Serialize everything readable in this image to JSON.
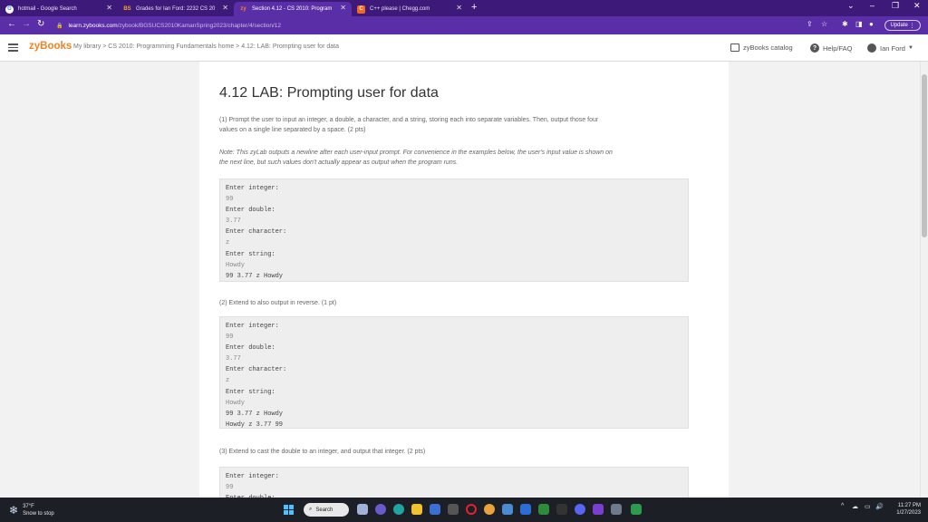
{
  "browser": {
    "tabs": [
      {
        "label": "hotmail - Google Search",
        "favicon_glyph": "G"
      },
      {
        "label": "Grades for Ian Ford: 2232 CS 20",
        "favicon_glyph": "BS"
      },
      {
        "label": "Section 4.12 - CS 2010: Program",
        "favicon_glyph": "zy"
      },
      {
        "label": "C++ please | Chegg.com",
        "favicon_glyph": "C"
      }
    ],
    "new_tab_glyph": "+",
    "url_host": "learn.zybooks.com",
    "url_path": "/zybook/BGSUCS2010KamanSpring2023/chapter/4/section/12",
    "update_label": "Update"
  },
  "header": {
    "logo": "zyBooks",
    "breadcrumb": "My library > CS 2010: Programming Fundamentals home > 4.12: LAB: Prompting user for data",
    "catalog_label": "zyBooks catalog",
    "help_label": "Help/FAQ",
    "user_label": "Ian Ford"
  },
  "content": {
    "title": "4.12 LAB: Prompting user for data",
    "intro_line1": "(1) Prompt the user to input an integer, a double, a character, and a string, storing each into separate variables. Then, output those four",
    "intro_line2": "values on a single line separated by a space. (2 pts)",
    "note_line1": "Note: This zyLab outputs a newline after each user-input prompt. For convenience in the examples below, the user's input value is shown on",
    "note_line2": "the next line, but such values don't actually appear as output when the program runs.",
    "example1": [
      {
        "text": "Enter integer:",
        "kind": "prompt"
      },
      {
        "text": "99",
        "kind": "input"
      },
      {
        "text": "Enter double:",
        "kind": "prompt"
      },
      {
        "text": "3.77",
        "kind": "input"
      },
      {
        "text": "Enter character:",
        "kind": "prompt"
      },
      {
        "text": "z",
        "kind": "input"
      },
      {
        "text": "Enter string:",
        "kind": "prompt"
      },
      {
        "text": "Howdy",
        "kind": "input"
      },
      {
        "text": "99 3.77 z Howdy",
        "kind": "output"
      }
    ],
    "part2": "(2) Extend to also output in reverse. (1 pt)",
    "example2": [
      {
        "text": "Enter integer:",
        "kind": "prompt"
      },
      {
        "text": "99",
        "kind": "input"
      },
      {
        "text": "Enter double:",
        "kind": "prompt"
      },
      {
        "text": "3.77",
        "kind": "input"
      },
      {
        "text": "Enter character:",
        "kind": "prompt"
      },
      {
        "text": "z",
        "kind": "input"
      },
      {
        "text": "Enter string:",
        "kind": "prompt"
      },
      {
        "text": "Howdy",
        "kind": "input"
      },
      {
        "text": "99 3.77 z Howdy",
        "kind": "output"
      },
      {
        "text": "Howdy z 3.77 99",
        "kind": "output"
      }
    ],
    "part3": "(3) Extend to cast the double to an integer, and output that integer. (2 pts)",
    "example3": [
      {
        "text": "Enter integer:",
        "kind": "prompt"
      },
      {
        "text": "99",
        "kind": "input"
      },
      {
        "text": "Enter double:",
        "kind": "prompt"
      }
    ]
  },
  "taskbar": {
    "weather_temp": "37°F",
    "weather_desc": "Snow to stop",
    "search_label": "Search",
    "time": "11:27 PM",
    "date": "1/27/2023"
  },
  "colors": {
    "tab_bar": "#3d1a7a",
    "address_bar": "#5a2ea6",
    "zybooks_orange": "#f58220",
    "taskbar": "#1c1f26"
  }
}
